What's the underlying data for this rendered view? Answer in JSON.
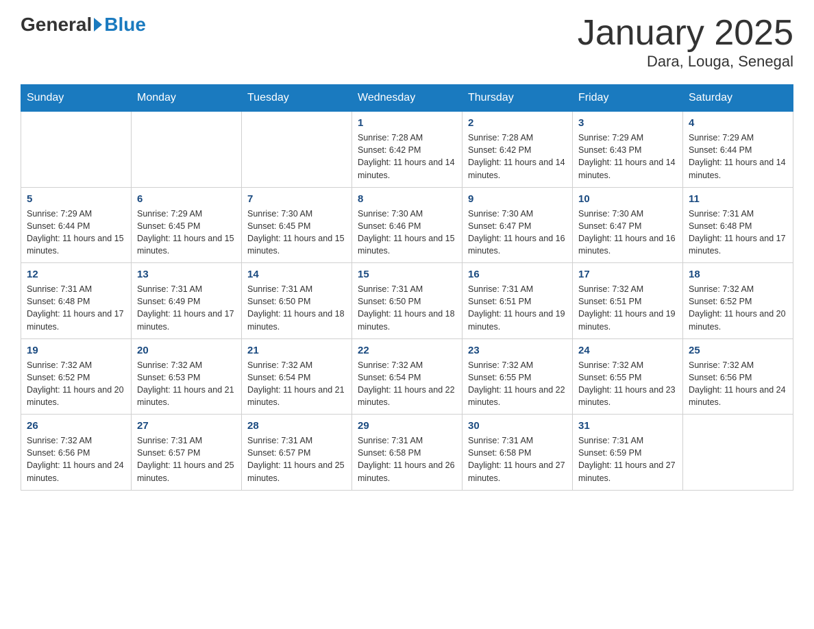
{
  "header": {
    "logo_general": "General",
    "logo_blue": "Blue",
    "month_title": "January 2025",
    "location": "Dara, Louga, Senegal"
  },
  "weekdays": [
    "Sunday",
    "Monday",
    "Tuesday",
    "Wednesday",
    "Thursday",
    "Friday",
    "Saturday"
  ],
  "weeks": [
    [
      {
        "day": "",
        "info": ""
      },
      {
        "day": "",
        "info": ""
      },
      {
        "day": "",
        "info": ""
      },
      {
        "day": "1",
        "info": "Sunrise: 7:28 AM\nSunset: 6:42 PM\nDaylight: 11 hours and 14 minutes."
      },
      {
        "day": "2",
        "info": "Sunrise: 7:28 AM\nSunset: 6:42 PM\nDaylight: 11 hours and 14 minutes."
      },
      {
        "day": "3",
        "info": "Sunrise: 7:29 AM\nSunset: 6:43 PM\nDaylight: 11 hours and 14 minutes."
      },
      {
        "day": "4",
        "info": "Sunrise: 7:29 AM\nSunset: 6:44 PM\nDaylight: 11 hours and 14 minutes."
      }
    ],
    [
      {
        "day": "5",
        "info": "Sunrise: 7:29 AM\nSunset: 6:44 PM\nDaylight: 11 hours and 15 minutes."
      },
      {
        "day": "6",
        "info": "Sunrise: 7:29 AM\nSunset: 6:45 PM\nDaylight: 11 hours and 15 minutes."
      },
      {
        "day": "7",
        "info": "Sunrise: 7:30 AM\nSunset: 6:45 PM\nDaylight: 11 hours and 15 minutes."
      },
      {
        "day": "8",
        "info": "Sunrise: 7:30 AM\nSunset: 6:46 PM\nDaylight: 11 hours and 15 minutes."
      },
      {
        "day": "9",
        "info": "Sunrise: 7:30 AM\nSunset: 6:47 PM\nDaylight: 11 hours and 16 minutes."
      },
      {
        "day": "10",
        "info": "Sunrise: 7:30 AM\nSunset: 6:47 PM\nDaylight: 11 hours and 16 minutes."
      },
      {
        "day": "11",
        "info": "Sunrise: 7:31 AM\nSunset: 6:48 PM\nDaylight: 11 hours and 17 minutes."
      }
    ],
    [
      {
        "day": "12",
        "info": "Sunrise: 7:31 AM\nSunset: 6:48 PM\nDaylight: 11 hours and 17 minutes."
      },
      {
        "day": "13",
        "info": "Sunrise: 7:31 AM\nSunset: 6:49 PM\nDaylight: 11 hours and 17 minutes."
      },
      {
        "day": "14",
        "info": "Sunrise: 7:31 AM\nSunset: 6:50 PM\nDaylight: 11 hours and 18 minutes."
      },
      {
        "day": "15",
        "info": "Sunrise: 7:31 AM\nSunset: 6:50 PM\nDaylight: 11 hours and 18 minutes."
      },
      {
        "day": "16",
        "info": "Sunrise: 7:31 AM\nSunset: 6:51 PM\nDaylight: 11 hours and 19 minutes."
      },
      {
        "day": "17",
        "info": "Sunrise: 7:32 AM\nSunset: 6:51 PM\nDaylight: 11 hours and 19 minutes."
      },
      {
        "day": "18",
        "info": "Sunrise: 7:32 AM\nSunset: 6:52 PM\nDaylight: 11 hours and 20 minutes."
      }
    ],
    [
      {
        "day": "19",
        "info": "Sunrise: 7:32 AM\nSunset: 6:52 PM\nDaylight: 11 hours and 20 minutes."
      },
      {
        "day": "20",
        "info": "Sunrise: 7:32 AM\nSunset: 6:53 PM\nDaylight: 11 hours and 21 minutes."
      },
      {
        "day": "21",
        "info": "Sunrise: 7:32 AM\nSunset: 6:54 PM\nDaylight: 11 hours and 21 minutes."
      },
      {
        "day": "22",
        "info": "Sunrise: 7:32 AM\nSunset: 6:54 PM\nDaylight: 11 hours and 22 minutes."
      },
      {
        "day": "23",
        "info": "Sunrise: 7:32 AM\nSunset: 6:55 PM\nDaylight: 11 hours and 22 minutes."
      },
      {
        "day": "24",
        "info": "Sunrise: 7:32 AM\nSunset: 6:55 PM\nDaylight: 11 hours and 23 minutes."
      },
      {
        "day": "25",
        "info": "Sunrise: 7:32 AM\nSunset: 6:56 PM\nDaylight: 11 hours and 24 minutes."
      }
    ],
    [
      {
        "day": "26",
        "info": "Sunrise: 7:32 AM\nSunset: 6:56 PM\nDaylight: 11 hours and 24 minutes."
      },
      {
        "day": "27",
        "info": "Sunrise: 7:31 AM\nSunset: 6:57 PM\nDaylight: 11 hours and 25 minutes."
      },
      {
        "day": "28",
        "info": "Sunrise: 7:31 AM\nSunset: 6:57 PM\nDaylight: 11 hours and 25 minutes."
      },
      {
        "day": "29",
        "info": "Sunrise: 7:31 AM\nSunset: 6:58 PM\nDaylight: 11 hours and 26 minutes."
      },
      {
        "day": "30",
        "info": "Sunrise: 7:31 AM\nSunset: 6:58 PM\nDaylight: 11 hours and 27 minutes."
      },
      {
        "day": "31",
        "info": "Sunrise: 7:31 AM\nSunset: 6:59 PM\nDaylight: 11 hours and 27 minutes."
      },
      {
        "day": "",
        "info": ""
      }
    ]
  ]
}
